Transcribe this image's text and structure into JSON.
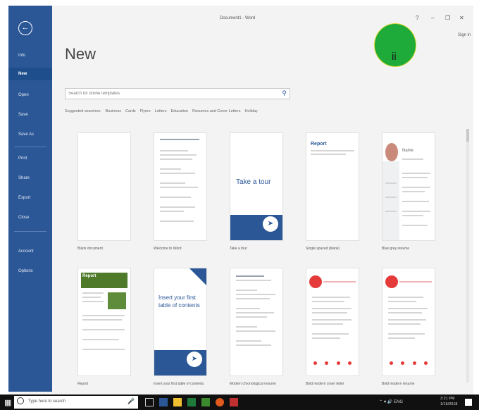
{
  "window": {
    "title": "Document1 - Word",
    "sign_in": "Sign in",
    "controls": [
      "?",
      "–",
      "❐",
      "✕"
    ]
  },
  "marker_label": "ii",
  "backstage": {
    "heading": "New",
    "back_icon": "back-arrow-icon",
    "sidebar_items": [
      "Info",
      "New",
      "Open",
      "Save",
      "Save As",
      "Print",
      "Share",
      "Export",
      "Close",
      "Account",
      "Options"
    ],
    "selected_item": "New"
  },
  "search": {
    "placeholder": "Search for online templates",
    "icon": "search-icon"
  },
  "suggested": [
    "Suggested searches:",
    "Business",
    "Cards",
    "Flyers",
    "Letters",
    "Education",
    "Resumes and Cover Letters",
    "Holiday"
  ],
  "templates": [
    {
      "label": "Blank document"
    },
    {
      "label": "Welcome to Word"
    },
    {
      "label": "Take a tour"
    },
    {
      "label": "Single spaced (blank)"
    },
    {
      "label": "Blue grey resume"
    },
    {
      "label": "Report"
    },
    {
      "label": "Insert your first table of contents"
    },
    {
      "label": "Modern chronological resume"
    },
    {
      "label": "Bold modern cover letter"
    },
    {
      "label": "Bold modern resume"
    }
  ],
  "template_text": {
    "tour": "Take a tour",
    "toc": "Insert your first table of contents",
    "report_title": "Report",
    "name_label": "Name"
  },
  "taskbar": {
    "search_placeholder": "Type here to search",
    "clock_time": "3:21 PM",
    "clock_date": "1/16/2018",
    "tray_text": "ENG"
  },
  "colors": {
    "word_blue": "#2b5797",
    "marker_green": "#1eab3a",
    "resume_red": "#e53a3a",
    "report_green": "#4e7a2a"
  }
}
